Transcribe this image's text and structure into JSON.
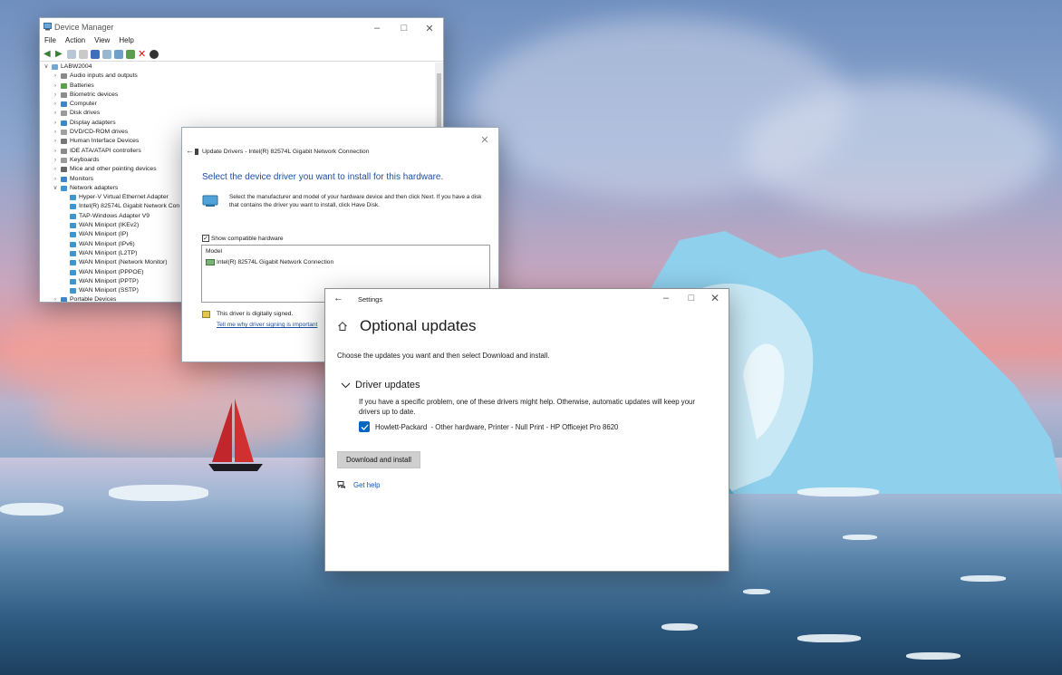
{
  "device_manager": {
    "title": "Device Manager",
    "menu": [
      "File",
      "Action",
      "View",
      "Help"
    ],
    "tree": [
      {
        "label": "LABW2004",
        "level": 0,
        "expanded": true,
        "icon": "computer-icon"
      },
      {
        "label": "Audio inputs and outputs",
        "level": 1,
        "icon": "speaker-icon"
      },
      {
        "label": "Batteries",
        "level": 1,
        "icon": "battery-icon"
      },
      {
        "label": "Biometric devices",
        "level": 1,
        "icon": "fingerprint-icon"
      },
      {
        "label": "Computer",
        "level": 1,
        "icon": "monitor-icon"
      },
      {
        "label": "Disk drives",
        "level": 1,
        "icon": "disk-icon"
      },
      {
        "label": "Display adapters",
        "level": 1,
        "icon": "display-adapter-icon"
      },
      {
        "label": "DVD/CD-ROM drives",
        "level": 1,
        "icon": "dvd-icon"
      },
      {
        "label": "Human Interface Devices",
        "level": 1,
        "icon": "hid-icon"
      },
      {
        "label": "IDE ATA/ATAPI controllers",
        "level": 1,
        "icon": "ide-icon"
      },
      {
        "label": "Keyboards",
        "level": 1,
        "icon": "keyboard-icon"
      },
      {
        "label": "Mice and other pointing devices",
        "level": 1,
        "icon": "mouse-icon"
      },
      {
        "label": "Monitors",
        "level": 1,
        "icon": "monitor-icon"
      },
      {
        "label": "Network adapters",
        "level": 1,
        "expanded": true,
        "icon": "network-adapter-icon"
      },
      {
        "label": "Hyper-V Virtual Ethernet Adapter",
        "level": 2,
        "icon": "network-adapter-icon"
      },
      {
        "label": "Intel(R) 82574L Gigabit Network Con",
        "level": 2,
        "icon": "network-adapter-icon"
      },
      {
        "label": "TAP-Windows Adapter V9",
        "level": 2,
        "icon": "network-adapter-icon"
      },
      {
        "label": "WAN Miniport (IKEv2)",
        "level": 2,
        "icon": "network-adapter-icon"
      },
      {
        "label": "WAN Miniport (IP)",
        "level": 2,
        "icon": "network-adapter-icon"
      },
      {
        "label": "WAN Miniport (IPv6)",
        "level": 2,
        "icon": "network-adapter-icon"
      },
      {
        "label": "WAN Miniport (L2TP)",
        "level": 2,
        "icon": "network-adapter-icon"
      },
      {
        "label": "WAN Miniport (Network Monitor)",
        "level": 2,
        "icon": "network-adapter-icon"
      },
      {
        "label": "WAN Miniport (PPPOE)",
        "level": 2,
        "icon": "network-adapter-icon"
      },
      {
        "label": "WAN Miniport (PPTP)",
        "level": 2,
        "icon": "network-adapter-icon"
      },
      {
        "label": "WAN Miniport (SSTP)",
        "level": 2,
        "icon": "network-adapter-icon"
      },
      {
        "label": "Portable Devices",
        "level": 1,
        "icon": "portable-device-icon"
      }
    ]
  },
  "wizard": {
    "title": "Update Drivers - Intel(R) 82574L Gigabit Network Connection",
    "heading": "Select the device driver you want to install for this hardware.",
    "description": "Select the manufacturer and model of your hardware device and then click Next. If you have a disk that contains the driver you want to install, click Have Disk.",
    "show_compatible_label": "Show compatible hardware",
    "show_compatible_checked": true,
    "model_header": "Model",
    "model_item": "Intel(R) 82574L Gigabit Network Connection",
    "signed_text": "This driver is digitally signed.",
    "signing_link": "Tell me why driver signing is important"
  },
  "settings": {
    "window_title": "Settings",
    "page_title": "Optional updates",
    "intro": "Choose the updates you want and then select Download and install.",
    "section_title": "Driver updates",
    "section_desc": "If you have a specific problem, one of these drivers might help. Otherwise, automatic updates will keep your drivers up to date.",
    "update_item": "Howlett-Packard  - Other hardware, Printer - Null Print - HP Officejet Pro 8620",
    "update_checked": true,
    "download_button": "Download and install",
    "help_link": "Get help",
    "accent": "#0067c0"
  }
}
